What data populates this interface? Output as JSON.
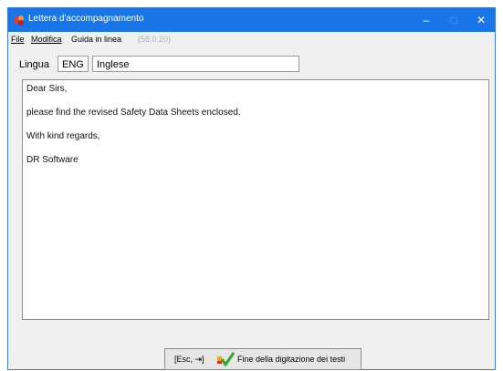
{
  "window": {
    "title": "Lettera d'accompagnamento",
    "controls": {
      "minimize": "–",
      "maximize": "□",
      "close": "✕"
    }
  },
  "menu": {
    "file": "File",
    "modifica": "Modifica",
    "guida": "Guida in linea",
    "version": "(58.0.20)"
  },
  "language": {
    "label": "Lingua",
    "code": "ENG",
    "name": "Inglese"
  },
  "letter": {
    "lines": [
      "Dear Sirs,",
      "please find the revised Safety Data Sheets enclosed.",
      "With kind regards,",
      "DR Software"
    ]
  },
  "footer": {
    "esc_label": "[Esc, ⇥]",
    "done_label": "Fine della digitazione dei testi",
    "done_icon": "checkmark-icon"
  },
  "colors": {
    "titlebar": "#1976e8",
    "window_bg": "#f0f0f0"
  }
}
